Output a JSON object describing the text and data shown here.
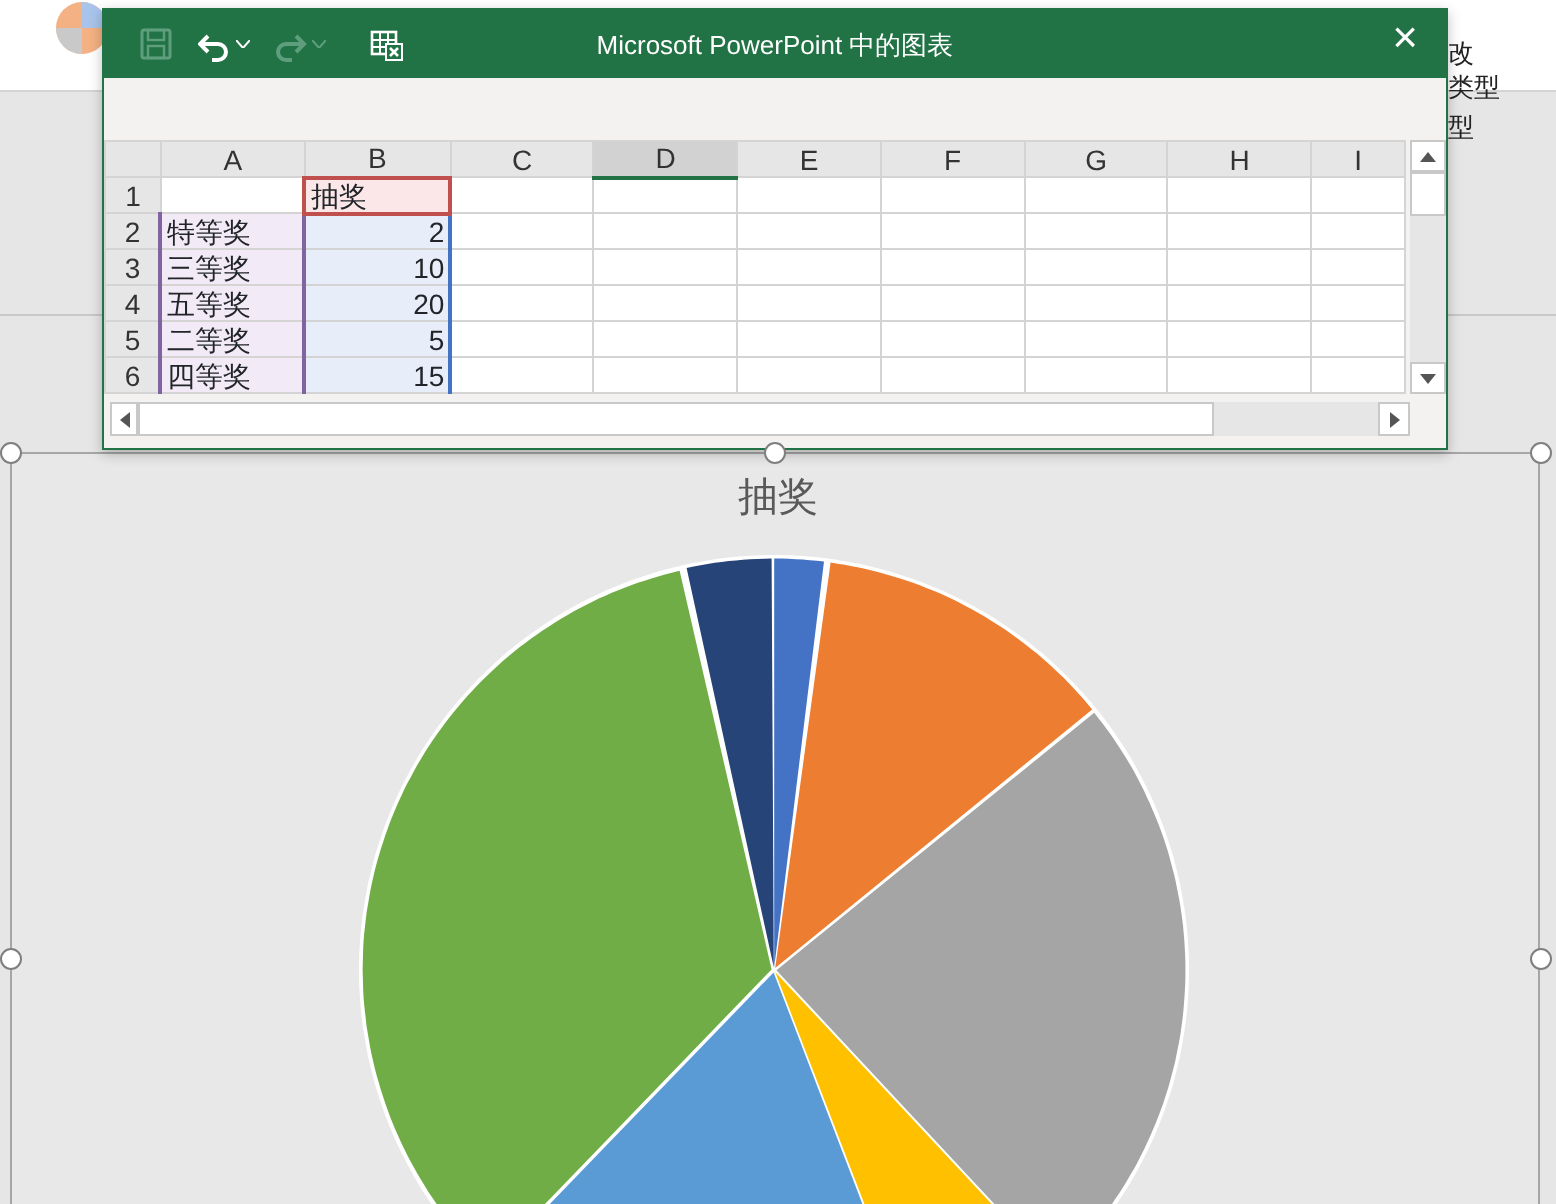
{
  "ribbon": {
    "labels": [
      "改",
      "类型",
      "型"
    ]
  },
  "window": {
    "title": "Microsoft PowerPoint 中的图表",
    "close": "×",
    "toolbar": [
      {
        "kind": "save",
        "disabled": true
      },
      {
        "kind": "undo",
        "disabled": false
      },
      {
        "kind": "redo",
        "disabled": true
      },
      {
        "kind": "sheet",
        "disabled": false
      }
    ]
  },
  "sheet": {
    "columns": [
      {
        "label": "A",
        "selected": false
      },
      {
        "label": "B",
        "selected": false
      },
      {
        "label": "C",
        "selected": false
      },
      {
        "label": "D",
        "selected": true
      },
      {
        "label": "E",
        "selected": false
      },
      {
        "label": "F",
        "selected": false
      },
      {
        "label": "G",
        "selected": false
      },
      {
        "label": "H",
        "selected": false
      },
      {
        "label": "I",
        "selected": false
      }
    ],
    "rows": [
      {
        "number": "1",
        "kind": "header",
        "b": "抽奖"
      },
      {
        "number": "2",
        "kind": "data",
        "a": "特等奖",
        "b": "2"
      },
      {
        "number": "3",
        "kind": "data",
        "a": "三等奖",
        "b": "10"
      },
      {
        "number": "4",
        "kind": "data",
        "a": "五等奖",
        "b": "20"
      },
      {
        "number": "5",
        "kind": "data",
        "a": "二等奖",
        "b": "5"
      },
      {
        "number": "6",
        "kind": "data",
        "a": "四等奖",
        "b": "15"
      }
    ]
  },
  "chart": {
    "title": "抽奖"
  }
}
